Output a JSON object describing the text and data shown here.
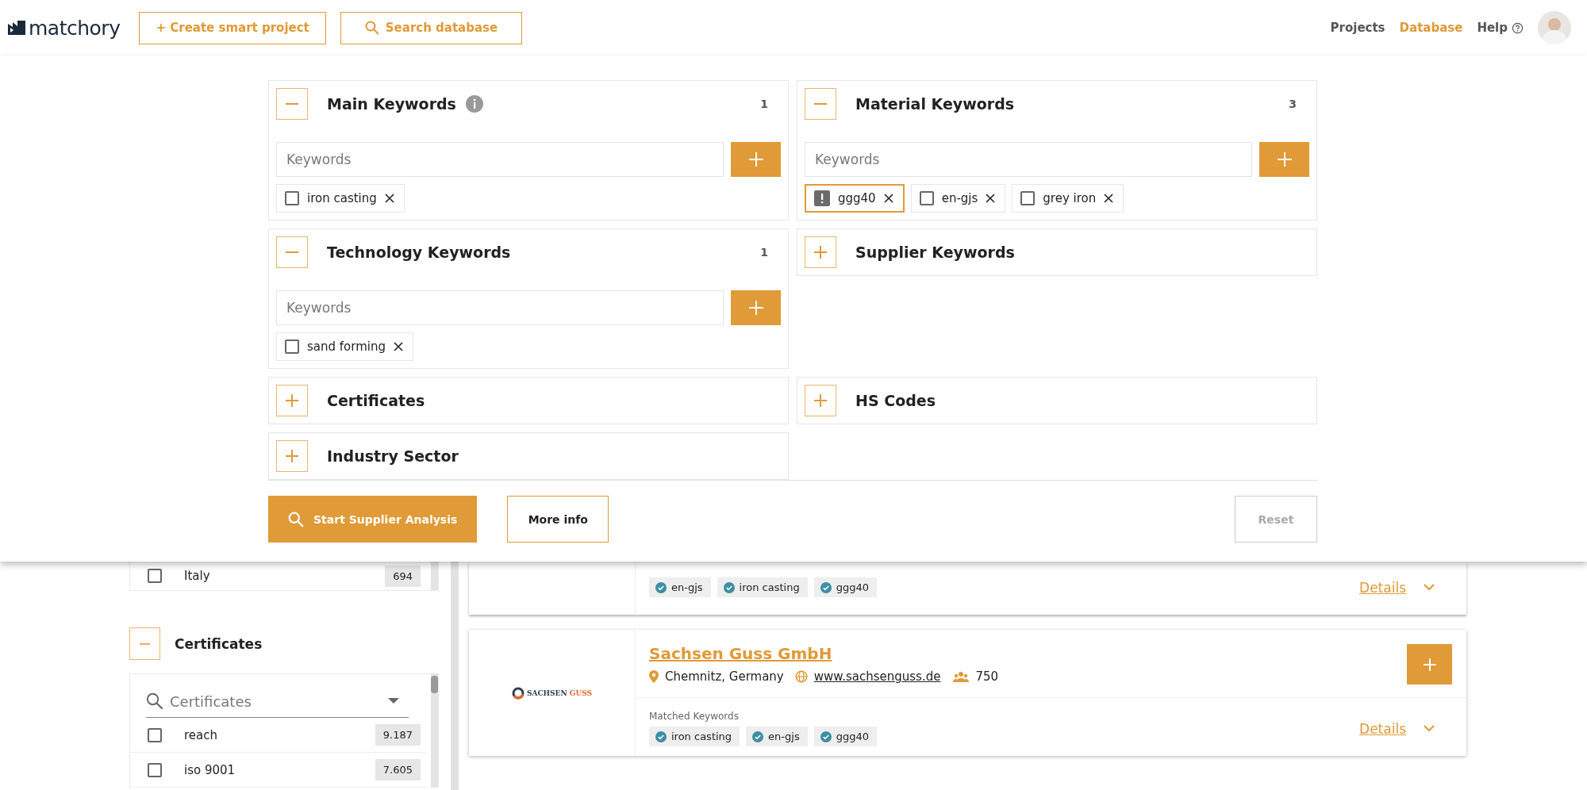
{
  "header": {
    "logo": "matchory",
    "actions": [
      {
        "label": "+ Create smart project",
        "kind": "plain"
      },
      {
        "label": "Search database",
        "kind": "search"
      }
    ],
    "nav": [
      {
        "label": "Projects",
        "selected": false,
        "help": false
      },
      {
        "label": "Database",
        "selected": true,
        "help": false
      },
      {
        "label": "Help",
        "selected": false,
        "help": true
      }
    ]
  },
  "filter_panel": {
    "sections": [
      {
        "title": "Main Keywords",
        "expanded": true,
        "info": true,
        "count": "1",
        "placeholder": "Keywords",
        "keywords": [
          {
            "label": "iron casting",
            "checked": false,
            "warning": false
          }
        ]
      },
      {
        "title": "Material Keywords",
        "expanded": true,
        "info": false,
        "count": "3",
        "placeholder": "Keywords",
        "keywords": [
          {
            "label": "ggg40",
            "warning": true
          },
          {
            "label": "en-gjs",
            "checked": false,
            "warning": false
          },
          {
            "label": "grey iron",
            "checked": false,
            "warning": false
          }
        ]
      },
      {
        "title": "Technology Keywords",
        "expanded": true,
        "info": false,
        "count": "1",
        "placeholder": "Keywords",
        "keywords": [
          {
            "label": "sand forming",
            "checked": false,
            "warning": false
          }
        ]
      },
      {
        "title": "Supplier Keywords",
        "expanded": false,
        "info": false
      },
      {
        "title": "Certificates",
        "expanded": false,
        "info": false
      },
      {
        "title": "HS Codes",
        "expanded": false,
        "info": false
      },
      {
        "title": "Industry Sector",
        "expanded": false,
        "info": false
      }
    ],
    "buttons": [
      {
        "label": "Start Supplier Analysis",
        "kind": "primary",
        "disabled": false
      },
      {
        "label": "More info",
        "kind": "secondary",
        "disabled": false
      },
      {
        "label": "Reset",
        "kind": "reset",
        "disabled": true
      }
    ]
  },
  "sidebar": {
    "country_rows": [
      {
        "label": "Italy",
        "count": "694",
        "checked": false
      }
    ],
    "certificates": {
      "title": "Certificates",
      "expanded": true,
      "placeholder": "Certificates",
      "items": [
        {
          "label": "reach",
          "count": "9.187",
          "checked": false
        },
        {
          "label": "iso 9001",
          "count": "7.605",
          "checked": false
        }
      ]
    }
  },
  "results": [
    {
      "kind": "partial",
      "matched_keywords": [
        "en-gjs",
        "iron casting",
        "ggg40"
      ],
      "details": "Details"
    },
    {
      "kind": "full",
      "name": "Sachsen Guss GmbH",
      "logo": [
        "SACHSEN",
        "GUSS"
      ],
      "location": "Chemnitz, Germany",
      "website": "www.sachsenguss.de",
      "employees": "750",
      "matched_label": "Matched Keywords",
      "matched_keywords": [
        "iron casting",
        "en-gjs",
        "ggg40"
      ],
      "details": "Details"
    }
  ]
}
